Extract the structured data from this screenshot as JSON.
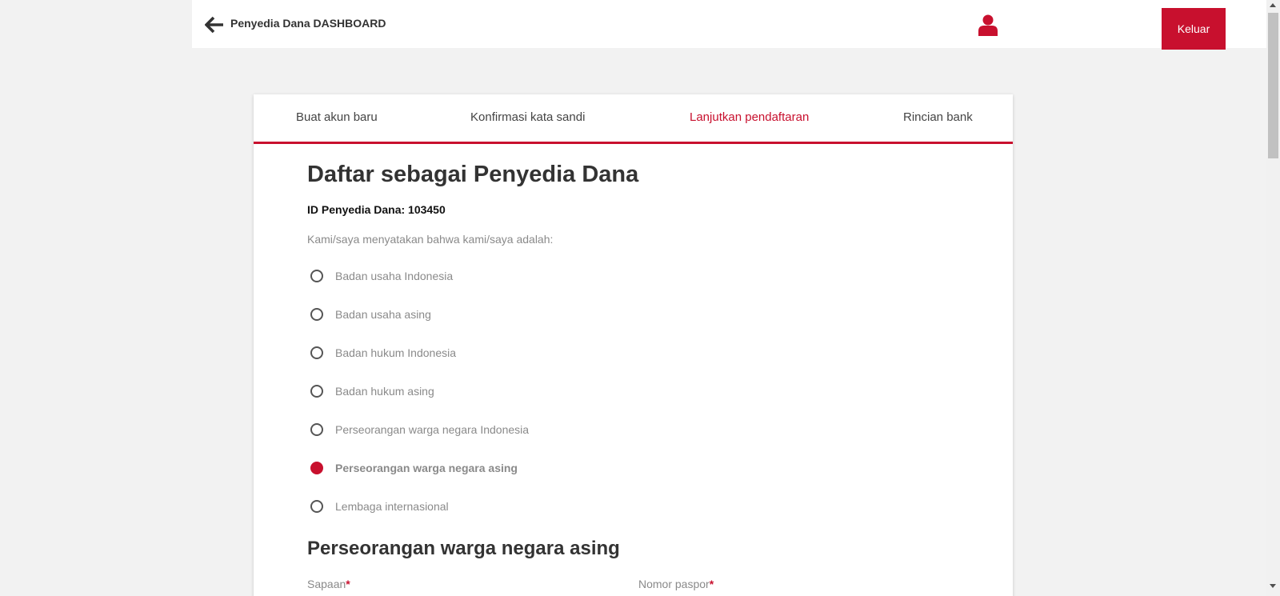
{
  "header": {
    "title": "Penyedia Dana DASHBOARD",
    "logout_label": "Keluar"
  },
  "steps": [
    {
      "label": "Buat akun baru"
    },
    {
      "label": "Konfirmasi kata sandi"
    },
    {
      "label": "Lanjutkan pendaftaran"
    },
    {
      "label": "Rincian bank"
    }
  ],
  "form": {
    "title": "Daftar sebagai Penyedia Dana",
    "provider_id": "ID Penyedia Dana: 103450",
    "statement": "Kami/saya menyatakan bahwa kami/saya adalah:",
    "options": [
      {
        "label": "Badan usaha Indonesia",
        "selected": false
      },
      {
        "label": "Badan usaha asing",
        "selected": false
      },
      {
        "label": "Badan hukum Indonesia",
        "selected": false
      },
      {
        "label": "Badan hukum asing",
        "selected": false
      },
      {
        "label": "Perseorangan warga negara Indonesia",
        "selected": false
      },
      {
        "label": "Perseorangan warga negara asing",
        "selected": true
      },
      {
        "label": "Lembaga internasional",
        "selected": false
      }
    ],
    "section_title": "Perseorangan warga negara asing",
    "fields": [
      {
        "label": "Sapaan",
        "required_mark": "*"
      },
      {
        "label": "Nomor paspor",
        "required_mark": "*"
      }
    ]
  },
  "colors": {
    "accent": "#c8102e",
    "background": "#f2f2f2"
  },
  "icons": {
    "back": "arrow-left-icon",
    "user": "user-icon"
  }
}
